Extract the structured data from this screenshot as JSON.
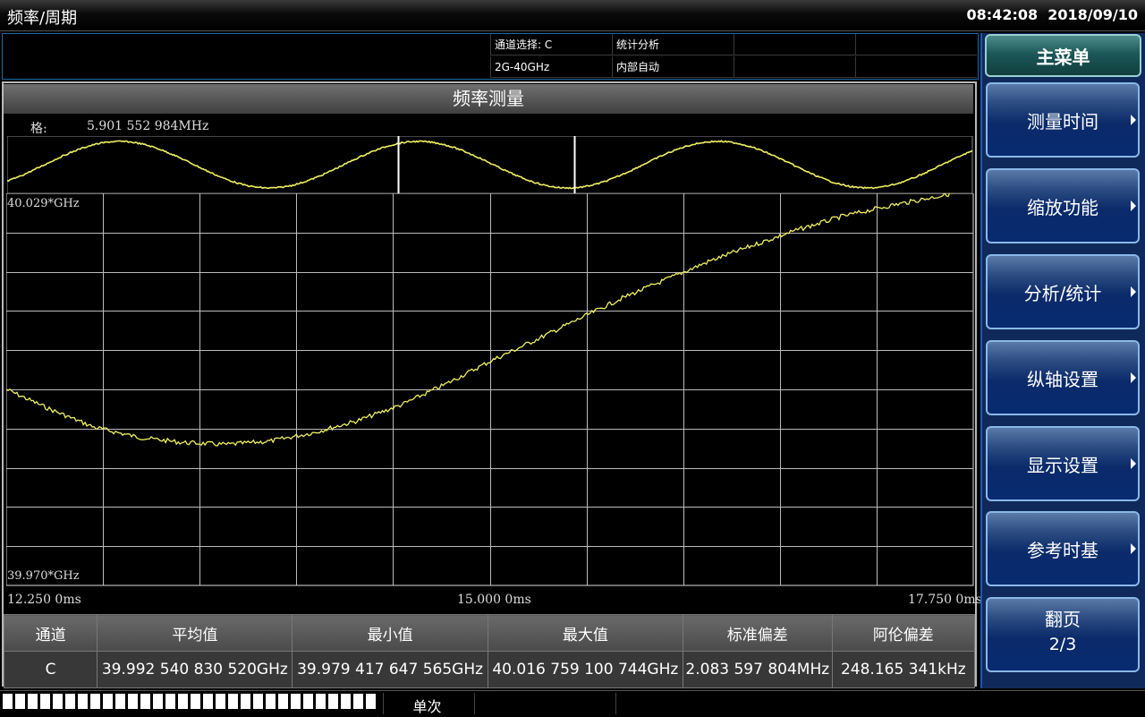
{
  "window": {
    "title": "频率/周期",
    "time": "08:42:08",
    "date": "2018/09/10"
  },
  "info": {
    "channel_select": "通道选择: C",
    "band": "2G-40GHz",
    "analysis": "统计分析",
    "trigger": "内部自动"
  },
  "panel": {
    "title": "频率测量"
  },
  "zoom": {
    "grid_label": "格:",
    "grid_value": "5.901 552 984MHz"
  },
  "plot": {
    "y_top": "40.029*GHz",
    "y_bottom": "39.970*GHz",
    "x_left": "12.250 0ms",
    "x_mid": "15.000 0ms",
    "x_right": "17.750 0ms",
    "trace_color": "#f0f060"
  },
  "chart_data": {
    "type": "line",
    "title": "",
    "xlabel": "",
    "ylabel": "",
    "x_unit": "ms",
    "y_unit": "GHz",
    "xlim": [
      12.25,
      17.75
    ],
    "ylim": [
      39.97,
      40.029
    ],
    "grid": true,
    "series": [
      {
        "x": [
          12.25,
          12.5,
          12.75,
          13.0,
          13.25,
          13.5,
          13.75,
          14.0,
          14.25,
          14.5,
          14.75,
          15.0,
          15.25,
          15.5,
          15.75,
          16.0,
          16.25,
          16.5,
          16.75,
          17.0,
          17.25,
          17.5,
          17.75
        ],
        "y": [
          39.9995,
          39.9965,
          39.9938,
          39.9923,
          39.9915,
          39.9912,
          39.9917,
          39.993,
          39.9948,
          39.9972,
          40.0003,
          40.0037,
          40.0068,
          40.01,
          40.0132,
          40.016,
          40.0188,
          40.0212,
          40.0235,
          40.0255,
          40.027,
          40.0283,
          40.0296
        ]
      }
    ],
    "overview": {
      "type": "line",
      "note": "",
      "periods": 5,
      "selection": [
        0.405,
        0.588
      ]
    }
  },
  "stats": {
    "headers": [
      "通道",
      "平均值",
      "最小值",
      "最大值",
      "标准偏差",
      "阿伦偏差"
    ],
    "row": [
      "C",
      "39.992 540 830 520GHz",
      "39.979 417 647 565GHz",
      "40.016 759 100 744GHz",
      "2.083 597 804MHz",
      "248.165 341kHz"
    ]
  },
  "menu": {
    "title": "主菜单",
    "items": [
      "测量时间",
      "缩放功能",
      "分析/统计",
      "纵轴设置",
      "显示设置",
      "参考时基"
    ],
    "page_label": "翻页",
    "page_num": "2/3"
  },
  "status": {
    "mode": "单次",
    "progress_segments": 30
  }
}
